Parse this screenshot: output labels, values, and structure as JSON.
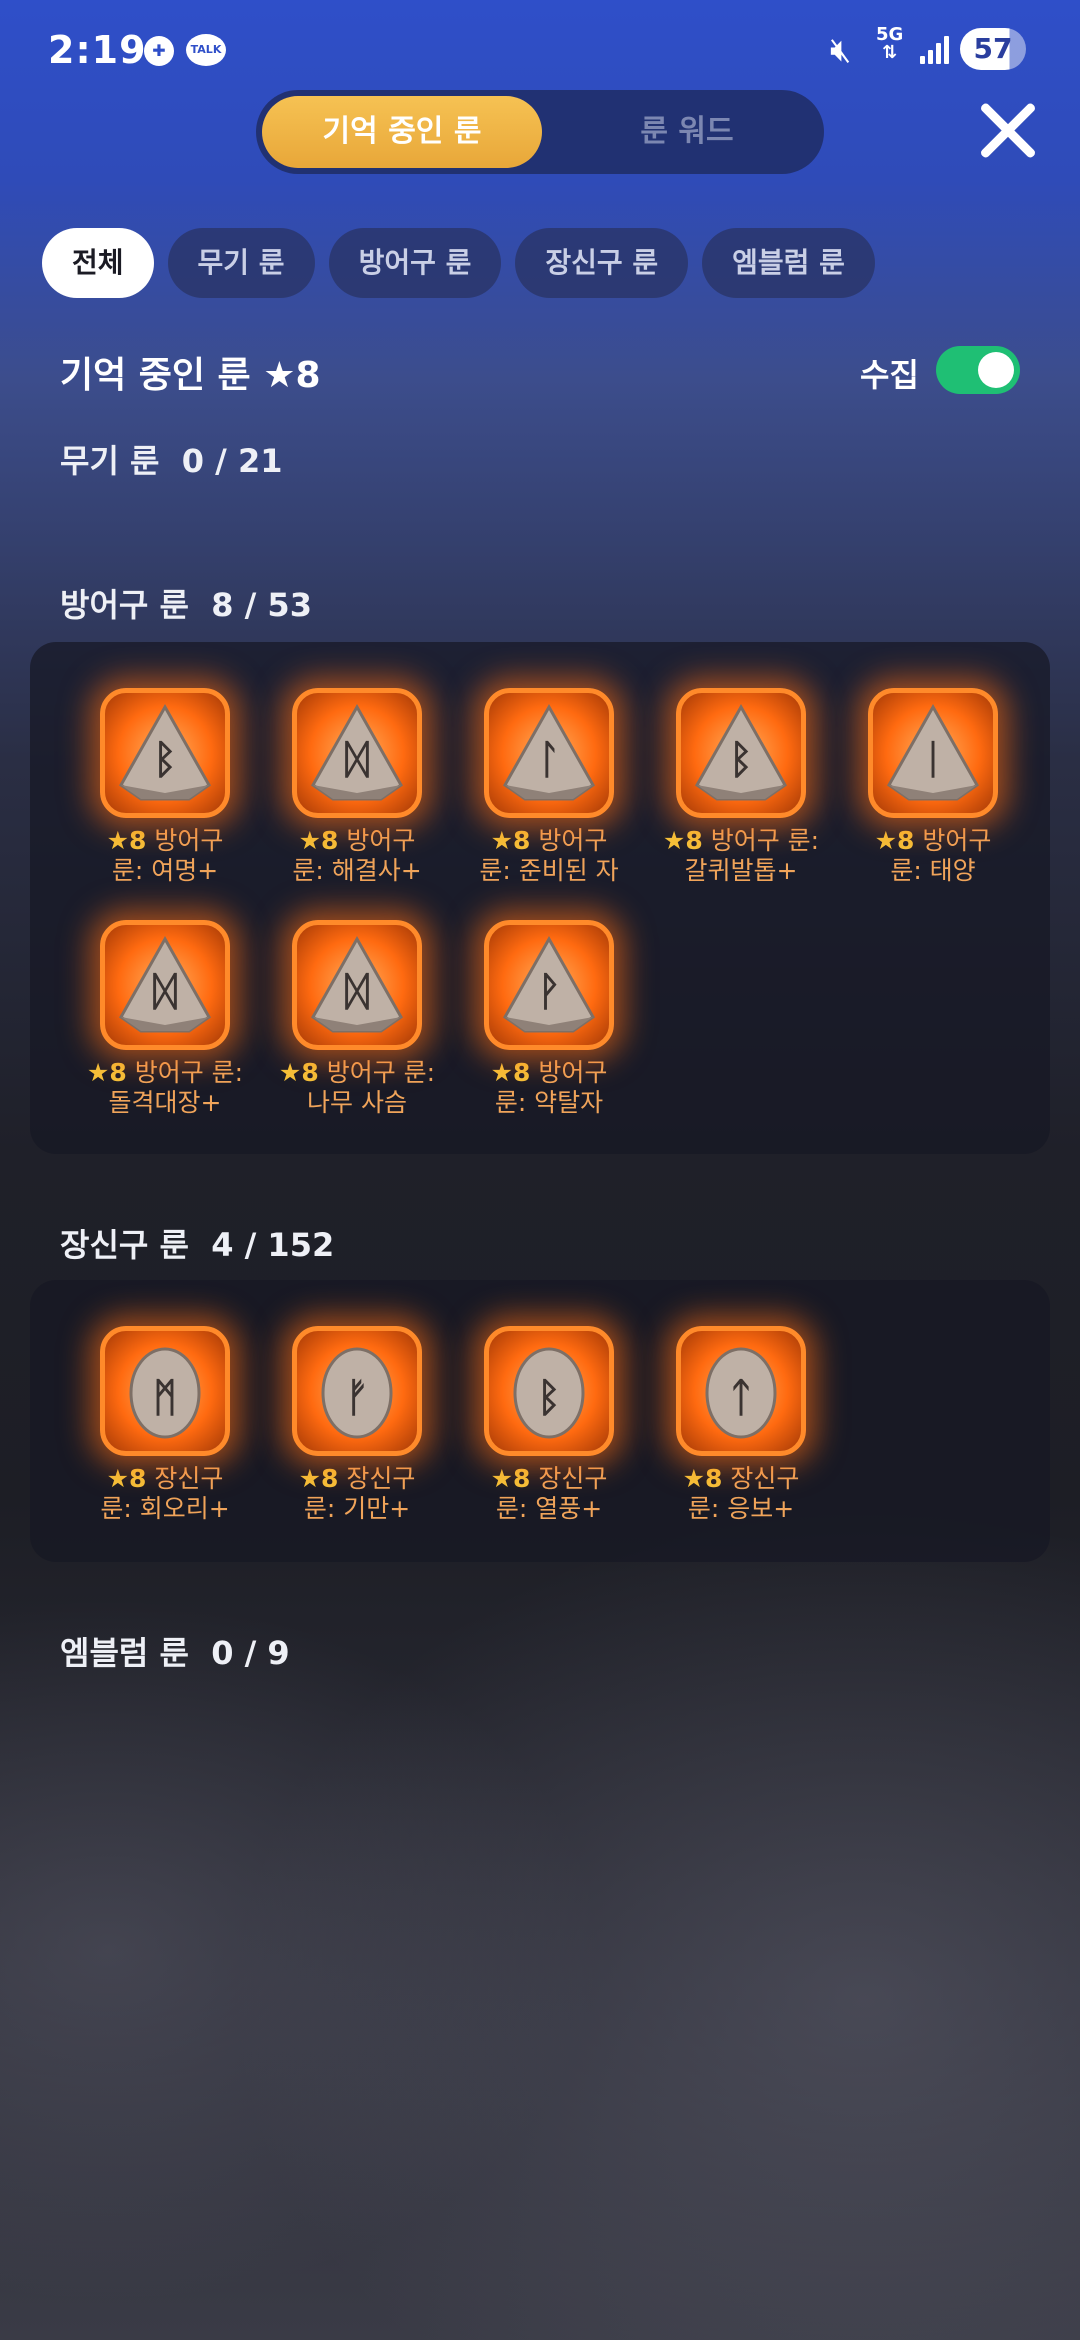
{
  "status_bar": {
    "time": "2:19",
    "network": "5G",
    "battery": "57",
    "game_icon": "gamepad-icon",
    "talk_icon": "TALK",
    "mute_icon": "mute-icon"
  },
  "top_tabs": [
    {
      "label": "기억 중인 룬",
      "active": true
    },
    {
      "label": "룬 워드",
      "active": false
    }
  ],
  "filters": [
    {
      "label": "전체",
      "active": true
    },
    {
      "label": "무기 룬"
    },
    {
      "label": "방어구 룬"
    },
    {
      "label": "장신구 룬"
    },
    {
      "label": "엠블럼 룬"
    }
  ],
  "header": {
    "title": "기억 중인 룬 ★8",
    "collect_label": "수집",
    "collect_on": true
  },
  "categories": {
    "weapon": {
      "name": "무기 룬",
      "count": "0 / 21"
    },
    "armor": {
      "name": "방어구 룬",
      "count": "8 / 53"
    },
    "accessory": {
      "name": "장신구 룬",
      "count": "4 / 152"
    },
    "emblem": {
      "name": "엠블럼 룬",
      "count": "0 / 9"
    }
  },
  "armor_runes": [
    {
      "star": "★8",
      "line1": "방어구",
      "line2": "룬: 여명+",
      "glyph": "ᛒ",
      "shape": "triangle"
    },
    {
      "star": "★8",
      "line1": "방어구",
      "line2": "룬: 해결사+",
      "glyph": "ᛞ",
      "shape": "triangle"
    },
    {
      "star": "★8",
      "line1": "방어구",
      "line2": "룬: 준비된 자",
      "glyph": "ᛚ",
      "shape": "triangle"
    },
    {
      "star": "★8",
      "line1": "방어구 룬:",
      "line2": "갈퀴발톱+",
      "glyph": "ᛒ",
      "shape": "triangle"
    },
    {
      "star": "★8",
      "line1": "방어구",
      "line2": "룬: 태양",
      "glyph": "ᛁ",
      "shape": "triangle"
    },
    {
      "star": "★8",
      "line1": "방어구 룬:",
      "line2": "돌격대장+",
      "glyph": "ᛞ",
      "shape": "triangle"
    },
    {
      "star": "★8",
      "line1": "방어구 룬:",
      "line2": "나무 사슴",
      "glyph": "ᛞ",
      "shape": "triangle"
    },
    {
      "star": "★8",
      "line1": "방어구",
      "line2": "룬: 약탈자",
      "glyph": "ᚹ",
      "shape": "triangle"
    }
  ],
  "accessory_runes": [
    {
      "star": "★8",
      "line1": "장신구",
      "line2": "룬: 회오리+",
      "glyph": "ᛗ",
      "shape": "oval"
    },
    {
      "star": "★8",
      "line1": "장신구",
      "line2": "룬: 기만+",
      "glyph": "ᚠ",
      "shape": "oval"
    },
    {
      "star": "★8",
      "line1": "장신구",
      "line2": "룬: 열풍+",
      "glyph": "ᛒ",
      "shape": "oval"
    },
    {
      "star": "★8",
      "line1": "장신구",
      "line2": "룬: 응보+",
      "glyph": "ᛏ",
      "shape": "oval"
    }
  ]
}
